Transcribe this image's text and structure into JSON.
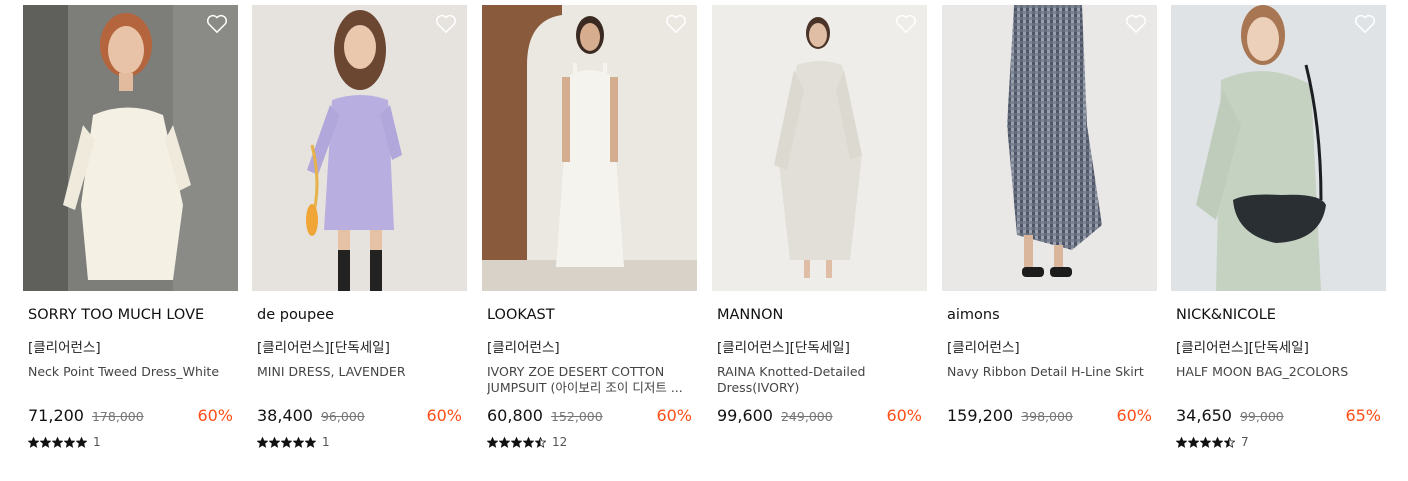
{
  "colors": {
    "discount": "#ff4e17",
    "text": "#111111",
    "muted": "#777777"
  },
  "products": [
    {
      "brand": "SORRY TOO MUCH LOVE",
      "tags": "[클리어런스]",
      "name": "Neck Point Tweed Dress_White",
      "price": "71,200",
      "original_price": "178,000",
      "discount": "60%",
      "rating": 5,
      "review_count": "1"
    },
    {
      "brand": "de poupee",
      "tags": "[클리어런스][단독세일]",
      "name": "MINI DRESS, LAVENDER",
      "price": "38,400",
      "original_price": "96,000",
      "discount": "60%",
      "rating": 5,
      "review_count": "1"
    },
    {
      "brand": "LOOKAST",
      "tags": "[클리어런스]",
      "name": "IVORY ZOE DESERT COTTON JUMPSUIT (아이보리 조이 디저트 ...",
      "price": "60,800",
      "original_price": "152,000",
      "discount": "60%",
      "rating": 4.5,
      "review_count": "12"
    },
    {
      "brand": "MANNON",
      "tags": "[클리어런스][단독세일]",
      "name": "RAINA Knotted-Detailed Dress(IVORY)",
      "price": "99,600",
      "original_price": "249,000",
      "discount": "60%",
      "rating": null,
      "review_count": null
    },
    {
      "brand": "aimons",
      "tags": "[클리어런스]",
      "name": "Navy Ribbon Detail H-Line Skirt",
      "price": "159,200",
      "original_price": "398,000",
      "discount": "60%",
      "rating": null,
      "review_count": null
    },
    {
      "brand": "NICK&NICOLE",
      "tags": "[클리어런스][단독세일]",
      "name": "HALF MOON BAG_2COLORS",
      "price": "34,650",
      "original_price": "99,000",
      "discount": "65%",
      "rating": 4.5,
      "review_count": "7"
    }
  ]
}
